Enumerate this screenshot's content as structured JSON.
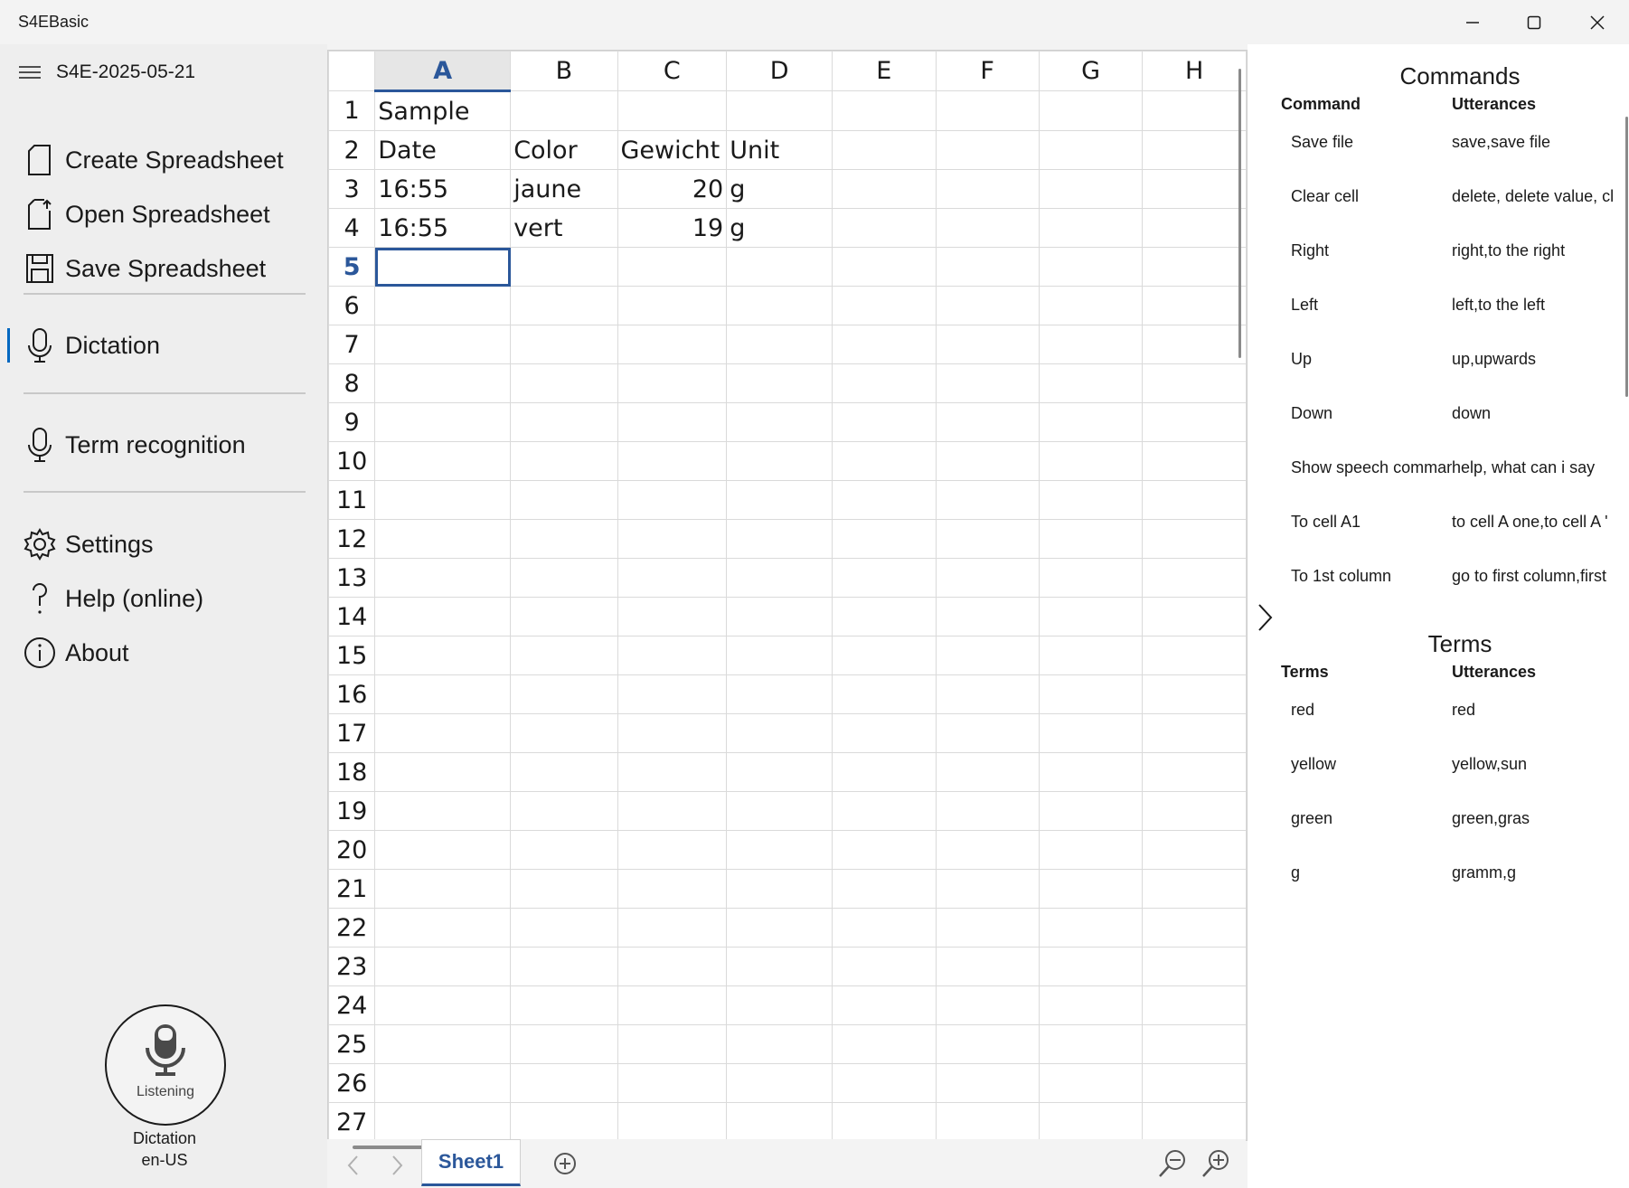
{
  "window": {
    "title": "S4EBasic"
  },
  "sidebar": {
    "file_name": "S4E-2025-05-21",
    "items": [
      {
        "label": "Create Spreadsheet"
      },
      {
        "label": "Open Spreadsheet"
      },
      {
        "label": "Save Spreadsheet"
      },
      {
        "label": "Dictation"
      },
      {
        "label": "Term recognition"
      },
      {
        "label": "Settings"
      },
      {
        "label": "Help (online)"
      },
      {
        "label": "About"
      }
    ],
    "mic": {
      "status": "Listening",
      "mode": "Dictation",
      "lang": "en-US"
    }
  },
  "sheet": {
    "columns": [
      "A",
      "B",
      "C",
      "D",
      "E",
      "F",
      "G",
      "H"
    ],
    "rows": [
      [
        "Sample",
        "",
        "",
        "",
        "",
        "",
        "",
        ""
      ],
      [
        "Date",
        "Color",
        "Gewicht",
        "Unit",
        "",
        "",
        "",
        ""
      ],
      [
        "16:55",
        "jaune",
        "20",
        "g",
        "",
        "",
        "",
        ""
      ],
      [
        "16:55",
        "vert",
        "19",
        "g",
        "",
        "",
        "",
        ""
      ]
    ],
    "row_numbers": [
      "1",
      "2",
      "3",
      "4",
      "5",
      "6",
      "7",
      "8",
      "9",
      "10",
      "11",
      "12",
      "13",
      "14",
      "15",
      "16",
      "17",
      "18",
      "19",
      "20",
      "21",
      "22",
      "23",
      "24",
      "25",
      "26",
      "27"
    ],
    "active_tab": "Sheet1"
  },
  "commands": {
    "title": "Commands",
    "header": [
      "Command",
      "Utterances"
    ],
    "rows": [
      [
        "Save file",
        "save,save file"
      ],
      [
        "Clear cell",
        "delete, delete value, cl"
      ],
      [
        "Right",
        "right,to the right"
      ],
      [
        "Left",
        "left,to the left"
      ],
      [
        "Up",
        "up,upwards"
      ],
      [
        "Down",
        "down"
      ],
      [
        "Show speech comman",
        "help, what can i say"
      ],
      [
        "To cell A1",
        "to cell A one,to cell A '"
      ],
      [
        "To 1st column",
        "go to first column,first"
      ]
    ]
  },
  "terms": {
    "title": "Terms",
    "header": [
      "Terms",
      "Utterances"
    ],
    "rows": [
      [
        "red",
        "red"
      ],
      [
        "yellow",
        "yellow,sun"
      ],
      [
        "green",
        "green,gras"
      ],
      [
        "g",
        "gramm,g"
      ]
    ]
  },
  "colors": {
    "accent": "#2b579a",
    "sidebar_bg": "#eeeeee",
    "selection_bar": "#0067c0"
  }
}
